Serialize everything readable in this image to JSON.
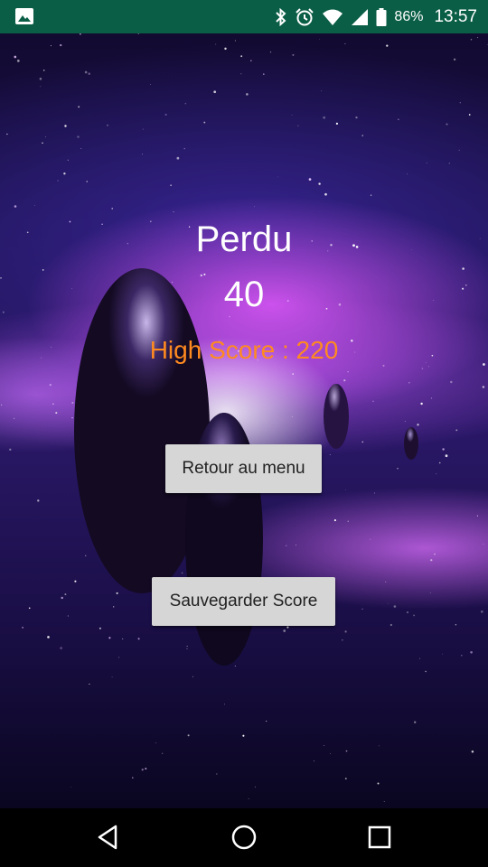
{
  "status_bar": {
    "battery_percent": "86%",
    "time": "13:57",
    "icons": [
      "image-notification-icon",
      "bluetooth-icon",
      "alarm-icon",
      "wifi-icon",
      "cellular-signal-icon",
      "battery-icon"
    ],
    "background_color": "#0b5e46"
  },
  "game_over": {
    "title": "Perdu",
    "score": "40",
    "high_score": "High Score : 220",
    "high_score_color": "#ff8a1f",
    "menu_button_label": "Retour au menu",
    "save_button_label": "Sauvegarder Score"
  },
  "nav_bar": {
    "icons": [
      "back-icon",
      "home-icon",
      "recents-icon"
    ]
  }
}
